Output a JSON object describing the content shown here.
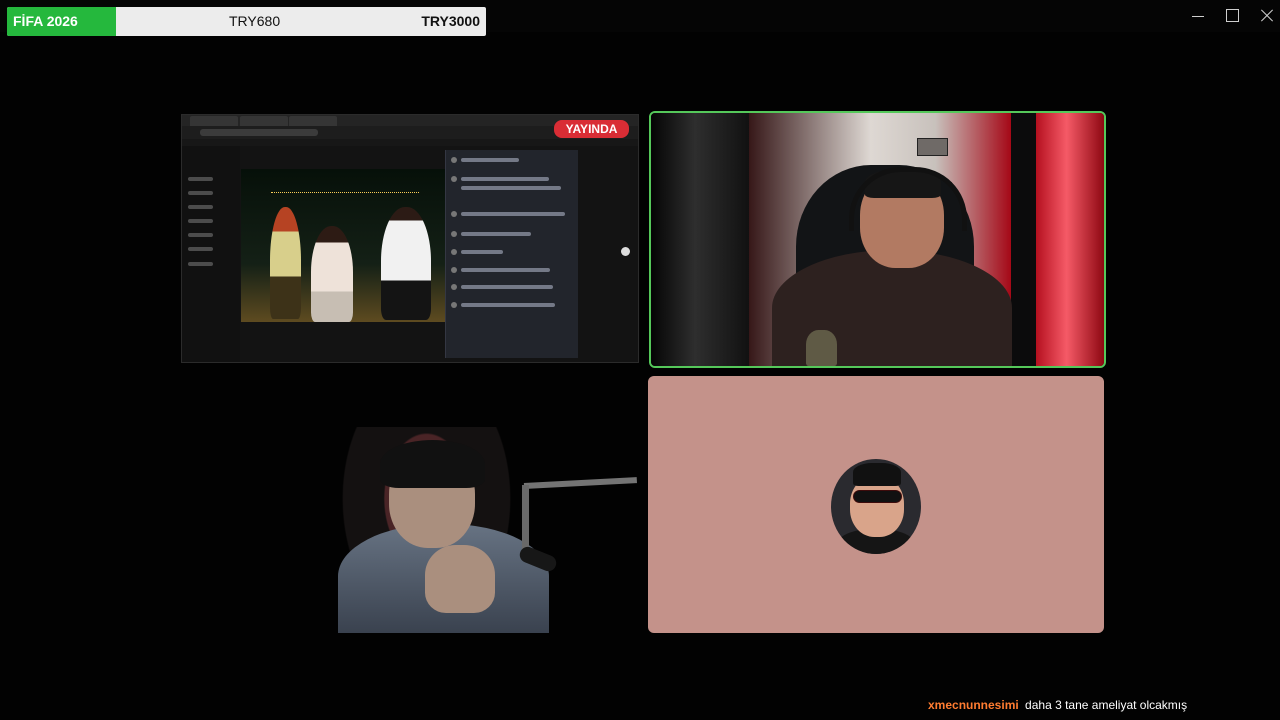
{
  "window": {
    "progress": {
      "title": "FİFA 2026",
      "current": "TRY680",
      "goal": "TRY3000",
      "fraction": 0.227,
      "fill_color": "#25b83d"
    },
    "controls": {
      "minimize_icon": "minimize-icon",
      "maximize_icon": "maximize-icon",
      "close_icon": "close-icon"
    }
  },
  "stream_grid": {
    "screen_share": {
      "badge": "YAYINDA",
      "badge_color": "#d92d35"
    },
    "active_speaker_color": "#55c85a",
    "avatar_background": "#c4928a"
  },
  "chat": {
    "username": "xmecnunnesimi",
    "message": "daha 3 tane ameliyat olcakmış",
    "username_color": "#ff7c31"
  }
}
